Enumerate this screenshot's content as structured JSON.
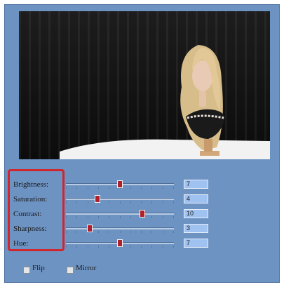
{
  "controls": [
    {
      "label": "Brightness:",
      "value": "7",
      "slider_fraction": 0.5
    },
    {
      "label": "Saturation:",
      "value": "4",
      "slider_fraction": 0.29
    },
    {
      "label": "Contrast:",
      "value": "10",
      "slider_fraction": 0.71
    },
    {
      "label": "Sharpness:",
      "value": "3",
      "slider_fraction": 0.22
    },
    {
      "label": "Hue:",
      "value": "7",
      "slider_fraction": 0.5
    }
  ],
  "options": {
    "flip_label": "Flip",
    "flip_checked": false,
    "mirror_label": "Mirror",
    "mirror_checked": false
  },
  "colors": {
    "panel_bg": "#6d93c3",
    "highlight_border": "#d0262e",
    "slider_thumb": "#b0202a",
    "value_box": "#9fc2f0"
  },
  "icons": {
    "slider_thumb": "red-square-thumb",
    "checkbox": "empty-checkbox"
  }
}
